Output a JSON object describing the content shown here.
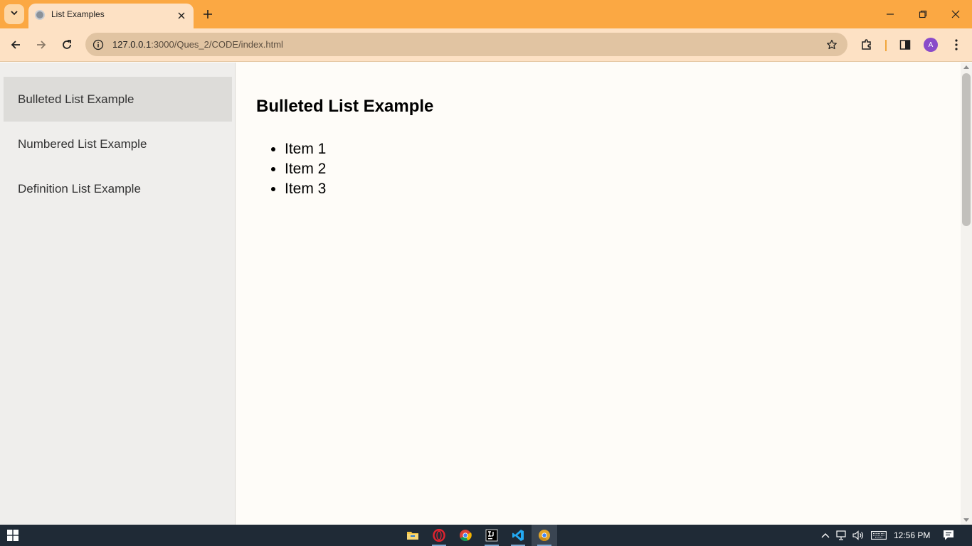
{
  "browser": {
    "tab_title": "List Examples",
    "url_host": "127.0.0.1",
    "url_rest": ":3000/Ques_2/CODE/index.html",
    "avatar_initial": "A",
    "accent_color": "#fba843"
  },
  "sidebar": {
    "items": [
      {
        "label": "Bulleted List Example",
        "active": true
      },
      {
        "label": "Numbered List Example",
        "active": false
      },
      {
        "label": "Definition List Example",
        "active": false
      }
    ]
  },
  "main": {
    "heading": "Bulleted List Example",
    "items": [
      "Item 1",
      "Item 2",
      "Item 3"
    ]
  },
  "taskbar": {
    "apps": [
      "file-explorer-icon",
      "opera-icon",
      "chrome-icon",
      "intellij-icon",
      "vscode-icon",
      "chrome-canary-icon"
    ],
    "time": "12:56 PM"
  }
}
